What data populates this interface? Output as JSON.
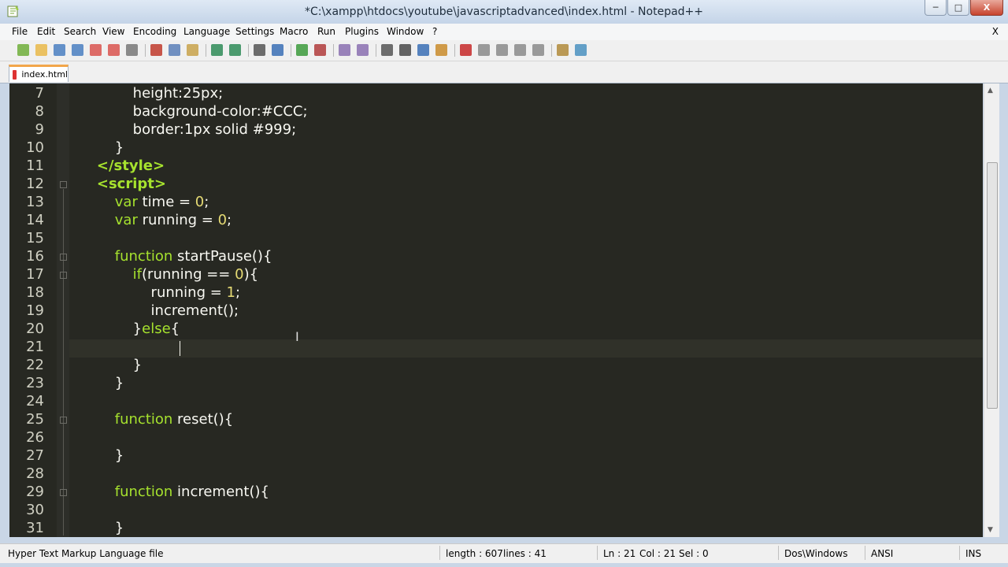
{
  "window": {
    "title": "*C:\\xampp\\htdocs\\youtube\\javascriptadvanced\\index.html - Notepad++",
    "minimize": "─",
    "maximize": "□",
    "close": "X"
  },
  "menu": {
    "items": [
      "File",
      "Edit",
      "Search",
      "View",
      "Encoding",
      "Language",
      "Settings",
      "Macro",
      "Run",
      "Plugins",
      "Window",
      "?"
    ],
    "close": "X"
  },
  "tabs": [
    {
      "label": "index.html",
      "active": true,
      "modified": true
    }
  ],
  "editor": {
    "theme": {
      "background": "#272822",
      "foreground": "#f8f8f2",
      "keyword": "#a6e22e",
      "number": "#e6db74"
    },
    "current_line": 21,
    "lines": [
      {
        "num": "7",
        "indent": "            ",
        "tokens": [
          {
            "t": "height:25px;",
            "c": "p"
          }
        ]
      },
      {
        "num": "8",
        "indent": "            ",
        "tokens": [
          {
            "t": "background-color:#CCC;",
            "c": "p"
          }
        ]
      },
      {
        "num": "9",
        "indent": "            ",
        "tokens": [
          {
            "t": "border:1px solid #999;",
            "c": "p"
          }
        ]
      },
      {
        "num": "10",
        "indent": "        ",
        "tokens": [
          {
            "t": "}",
            "c": "p"
          }
        ]
      },
      {
        "num": "11",
        "indent": "    ",
        "tokens": [
          {
            "t": "</style>",
            "c": "tg"
          }
        ]
      },
      {
        "num": "12",
        "indent": "    ",
        "tokens": [
          {
            "t": "<script>",
            "c": "tg"
          }
        ]
      },
      {
        "num": "13",
        "indent": "        ",
        "tokens": [
          {
            "t": "var",
            "c": "kw"
          },
          {
            "t": " time = ",
            "c": "p"
          },
          {
            "t": "0",
            "c": "nm"
          },
          {
            "t": ";",
            "c": "p"
          }
        ]
      },
      {
        "num": "14",
        "indent": "        ",
        "tokens": [
          {
            "t": "var",
            "c": "kw"
          },
          {
            "t": " running = ",
            "c": "p"
          },
          {
            "t": "0",
            "c": "nm"
          },
          {
            "t": ";",
            "c": "p"
          }
        ]
      },
      {
        "num": "15",
        "indent": "",
        "tokens": []
      },
      {
        "num": "16",
        "indent": "        ",
        "tokens": [
          {
            "t": "function",
            "c": "kw"
          },
          {
            "t": " startPause(){",
            "c": "p"
          }
        ]
      },
      {
        "num": "17",
        "indent": "            ",
        "tokens": [
          {
            "t": "if",
            "c": "kw"
          },
          {
            "t": "(running == ",
            "c": "p"
          },
          {
            "t": "0",
            "c": "nm"
          },
          {
            "t": "){",
            "c": "p"
          }
        ]
      },
      {
        "num": "18",
        "indent": "                ",
        "tokens": [
          {
            "t": "running = ",
            "c": "p"
          },
          {
            "t": "1",
            "c": "nm"
          },
          {
            "t": ";",
            "c": "p"
          }
        ]
      },
      {
        "num": "19",
        "indent": "                ",
        "tokens": [
          {
            "t": "increment();",
            "c": "p"
          }
        ]
      },
      {
        "num": "20",
        "indent": "            ",
        "tokens": [
          {
            "t": "}",
            "c": "p"
          },
          {
            "t": "else",
            "c": "kw"
          },
          {
            "t": "{",
            "c": "p"
          }
        ]
      },
      {
        "num": "21",
        "indent": "",
        "tokens": []
      },
      {
        "num": "22",
        "indent": "            ",
        "tokens": [
          {
            "t": "}",
            "c": "p"
          }
        ]
      },
      {
        "num": "23",
        "indent": "        ",
        "tokens": [
          {
            "t": "}",
            "c": "p"
          }
        ]
      },
      {
        "num": "24",
        "indent": "",
        "tokens": []
      },
      {
        "num": "25",
        "indent": "        ",
        "tokens": [
          {
            "t": "function",
            "c": "kw"
          },
          {
            "t": " reset(){",
            "c": "p"
          }
        ]
      },
      {
        "num": "26",
        "indent": "",
        "tokens": []
      },
      {
        "num": "27",
        "indent": "        ",
        "tokens": [
          {
            "t": "}",
            "c": "p"
          }
        ]
      },
      {
        "num": "28",
        "indent": "",
        "tokens": []
      },
      {
        "num": "29",
        "indent": "        ",
        "tokens": [
          {
            "t": "function",
            "c": "kw"
          },
          {
            "t": " increment(){",
            "c": "p"
          }
        ]
      },
      {
        "num": "30",
        "indent": "",
        "tokens": []
      },
      {
        "num": "31",
        "indent": "        ",
        "tokens": [
          {
            "t": "}",
            "c": "p"
          }
        ]
      }
    ],
    "fold_markers": [
      "12",
      "16",
      "17",
      "25",
      "29"
    ]
  },
  "toolbar": {
    "icons": [
      "new-file-icon",
      "open-file-icon",
      "save-icon",
      "save-all-icon",
      "close-icon",
      "close-all-icon",
      "print-icon",
      "cut-icon",
      "copy-icon",
      "paste-icon",
      "undo-icon",
      "redo-icon",
      "find-icon",
      "replace-icon",
      "zoom-in-icon",
      "zoom-out-icon",
      "sync-vertical-icon",
      "sync-horizontal-icon",
      "word-wrap-icon",
      "show-all-chars-icon",
      "indent-guide-icon",
      "doc-map-icon",
      "record-macro-icon",
      "stop-record-icon",
      "play-macro-icon",
      "play-multiple-icon",
      "save-macro-icon",
      "launch-browser-icon",
      "spell-check-icon"
    ]
  },
  "status": {
    "file_type": "Hyper Text Markup Language file",
    "length": "length : 607",
    "lines": "lines : 41",
    "ln": "Ln : 21",
    "col": "Col : 21",
    "sel": "Sel : 0",
    "eol": "Dos\\Windows",
    "encoding": "ANSI",
    "mode": "INS"
  }
}
